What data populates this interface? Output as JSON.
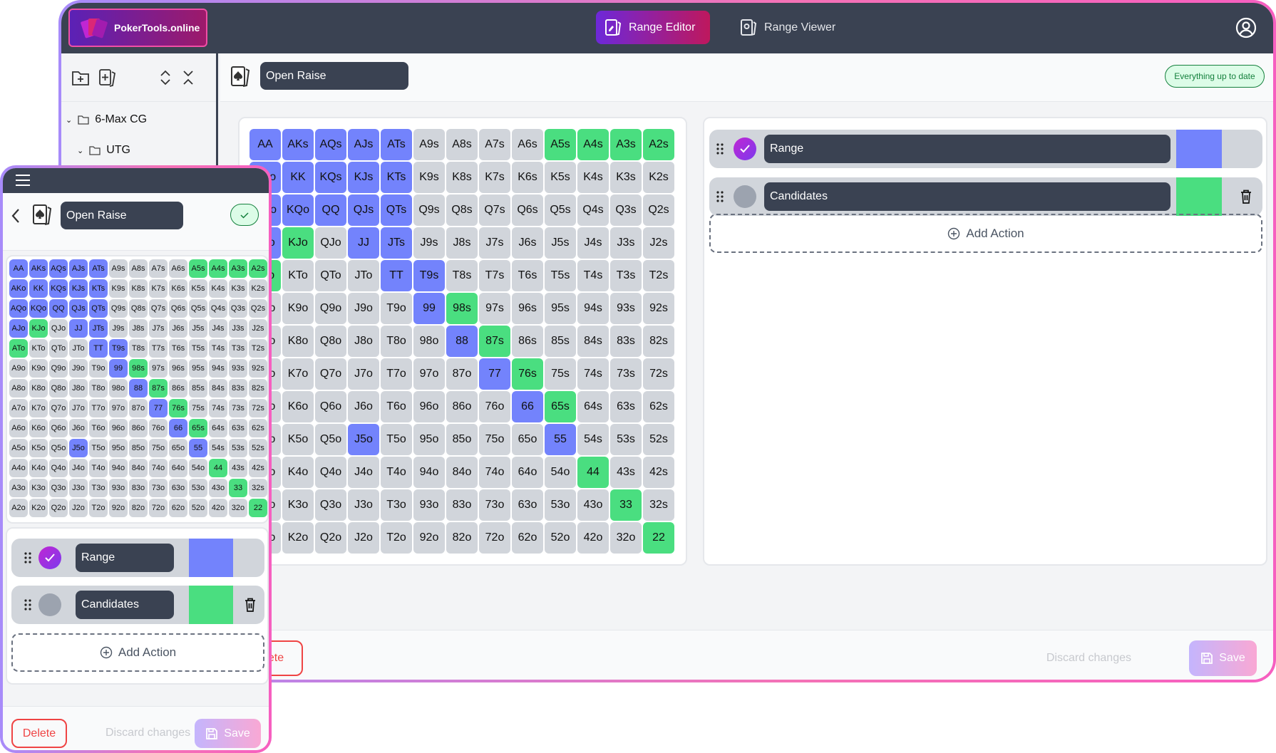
{
  "app": {
    "logo_text": "PokerTools.online"
  },
  "nav": {
    "tabs": [
      {
        "label": "Range Editor",
        "active": true,
        "icon": "edit-card-icon"
      },
      {
        "label": "Range Viewer",
        "active": false,
        "icon": "view-card-icon"
      }
    ],
    "profile_icon": "user-circle-icon"
  },
  "sidebar": {
    "toolbar": [
      "new-folder-icon",
      "new-range-icon",
      "expand-all-icon",
      "collapse-all-icon"
    ],
    "tree": [
      {
        "label": "6-Max CG",
        "expanded": true
      },
      {
        "label": "UTG",
        "expanded": true
      }
    ]
  },
  "editor": {
    "range_name": "Open Raise",
    "status": "Everything up to date"
  },
  "colors": {
    "range": "#7383fc",
    "candidates": "#4ade80",
    "none": "#d1d5db",
    "header": "#3a4252"
  },
  "grid": {
    "hands": [
      "AA AKs AQs AJs ATs A9s A8s A7s A6s A5s A4s A3s A2s",
      "AKo KK KQs KJs KTs K9s K8s K7s K6s K5s K4s K3s K2s",
      "AQo KQo QQ QJs QTs Q9s Q8s Q7s Q6s Q5s Q4s Q3s Q2s",
      "AJo KJo QJo JJ JTs J9s J8s J7s J6s J5s J4s J3s J2s",
      "ATo KTo QTo JTo TT T9s T8s T7s T6s T5s T4s T3s T2s",
      "A9o K9o Q9o J9o T9o 99 98s 97s 96s 95s 94s 93s 92s",
      "A8o K8o Q8o J8o T8o 98o 88 87s 86s 85s 84s 83s 82s",
      "A7o K7o Q7o J7o T7o 97o 87o 77 76s 75s 74s 73s 72s",
      "A6o K6o Q6o J6o T6o 96o 86o 76o 66 65s 64s 63s 62s",
      "A5o K5o Q5o J5o T5o 95o 85o 75o 65o 55 54s 53s 52s",
      "A4o K4o Q4o J4o T4o 94o 84o 74o 64o 54o 44 43s 42s",
      "A3o K3o Q3o J3o T3o 93o 83o 73o 63o 53o 43o 33 32s",
      "A2o K2o Q2o J2o T2o 92o 82o 72o 62o 52o 42o 32o 22"
    ],
    "assignments_legend": {
      "R": "range",
      "C": "candidates",
      "-": "none"
    },
    "assignments": [
      "RRRRR----CCCC",
      "RRRRR--------",
      "RRRRR--------",
      "RC-RR--------",
      "C---RR-------",
      "-----RC------",
      "------RC-----",
      "-------RC----",
      "--------RC---",
      "---R-----R---",
      "----------C--",
      "-----------C-",
      "------------C"
    ]
  },
  "actions": [
    {
      "name": "Range",
      "selected": true,
      "color": "#7383fc",
      "deletable": false
    },
    {
      "name": "Candidates",
      "selected": false,
      "color": "#4ade80",
      "deletable": true
    }
  ],
  "add_action_label": "Add Action",
  "footer": {
    "delete": "Delete",
    "delete_partial": "ete",
    "discard": "Discard changes",
    "save": "Save"
  }
}
